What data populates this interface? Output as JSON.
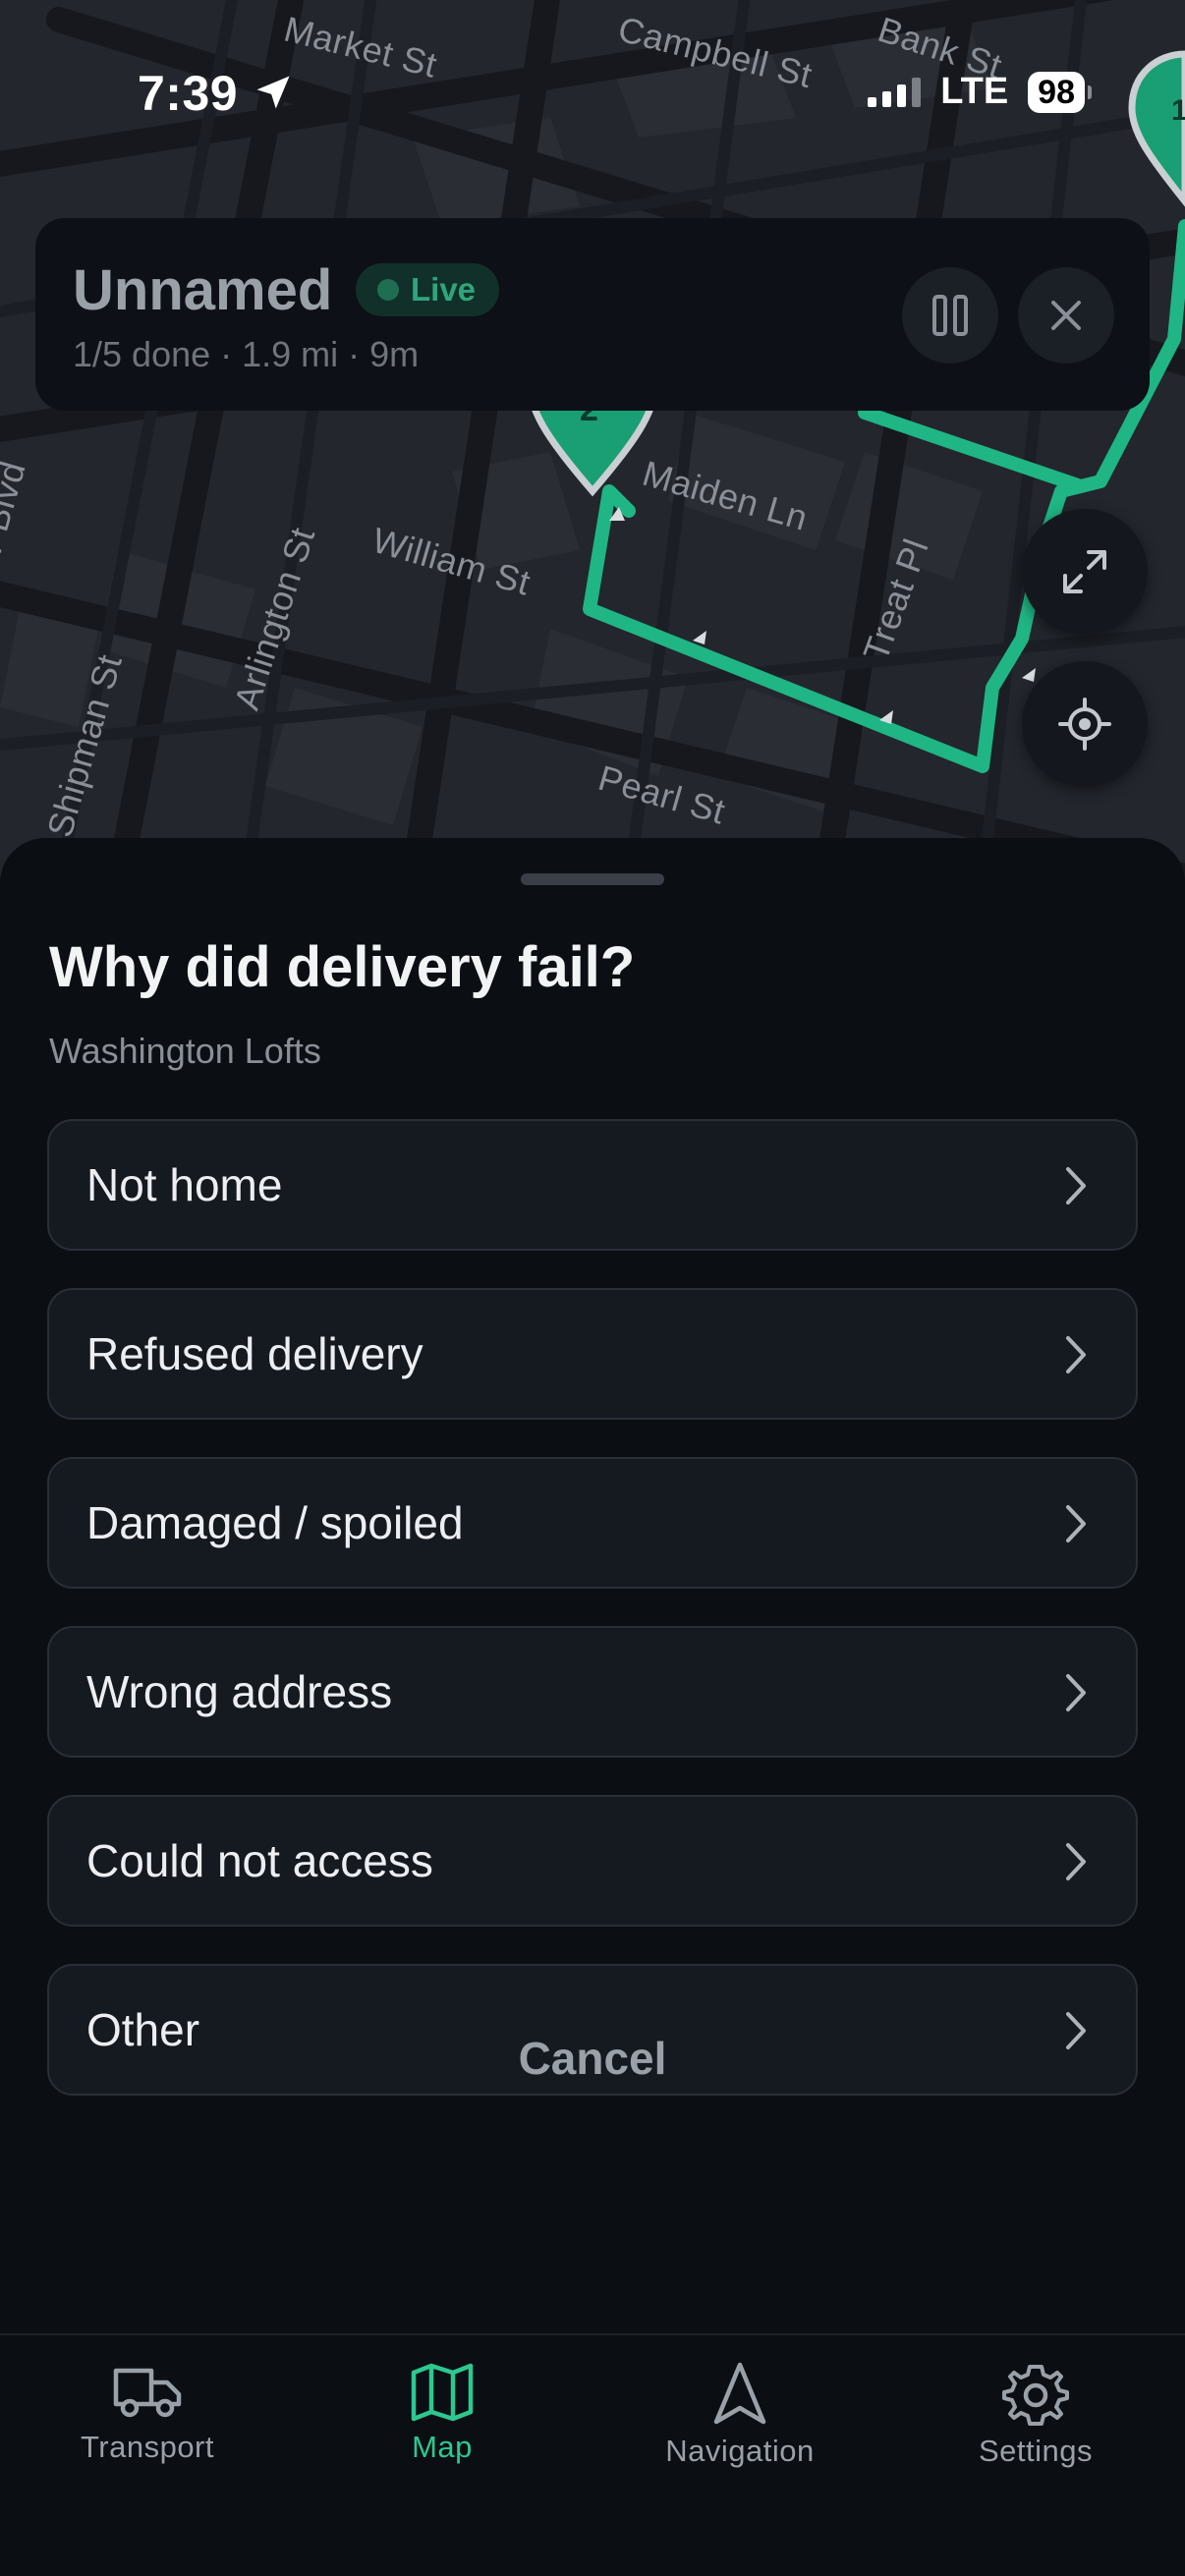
{
  "status_bar": {
    "time": "7:39",
    "network": "LTE",
    "battery": "98"
  },
  "map": {
    "streets": [
      "Market St",
      "Campbell St",
      "Bank St",
      "Maiden Ln",
      "William St",
      "Arlington St",
      "Treat Pl",
      "Shipman St",
      "Pearl St",
      "King Jr Blvd"
    ],
    "markers": [
      "1",
      "2"
    ]
  },
  "route_card": {
    "title": "Unnamed",
    "status": "Live",
    "summary": "1/5 done · 1.9 mi · 9m",
    "pause_icon": "pause-icon",
    "close_icon": "close-icon"
  },
  "map_controls": {
    "expand_icon": "expand-icon",
    "locate_icon": "locate-icon"
  },
  "sheet": {
    "title": "Why did delivery fail?",
    "subtitle": "Washington Lofts",
    "options": [
      {
        "label": "Not home"
      },
      {
        "label": "Refused delivery"
      },
      {
        "label": "Damaged / spoiled"
      },
      {
        "label": "Wrong address"
      },
      {
        "label": "Could not access"
      },
      {
        "label": "Other"
      }
    ],
    "cancel_label": "Cancel"
  },
  "tab_bar": {
    "tabs": [
      {
        "label": "Transport",
        "icon": "truck-icon"
      },
      {
        "label": "Map",
        "icon": "map-icon",
        "active": true
      },
      {
        "label": "Navigation",
        "icon": "navigation-icon"
      },
      {
        "label": "Settings",
        "icon": "gear-icon"
      }
    ],
    "active_color": "#2cc88f"
  },
  "colors": {
    "route": "#1fb584",
    "accent": "#2cc88f",
    "sheet_bg": "#0b0e13"
  }
}
